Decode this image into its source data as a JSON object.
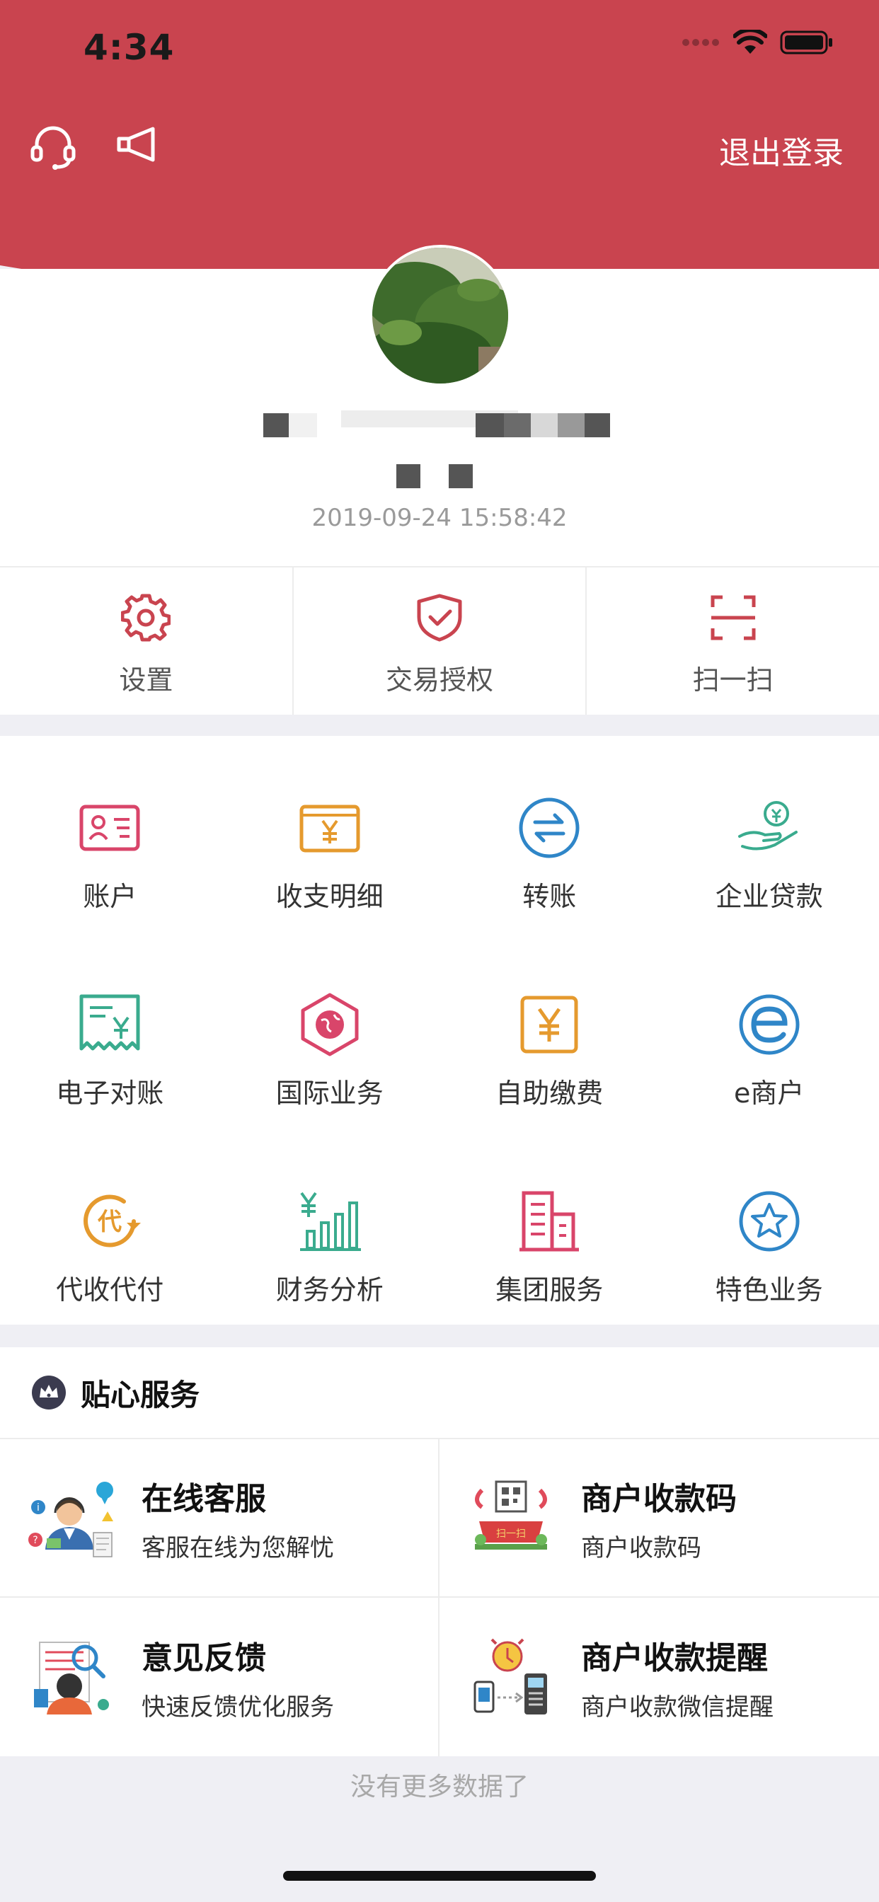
{
  "status_bar": {
    "time": "4:34"
  },
  "header": {
    "logout_label": "退出登录",
    "brand_color": "#c9444f",
    "icons": [
      "headset-icon",
      "megaphone-icon"
    ]
  },
  "profile": {
    "login_time": "2019-09-24 15:58:42"
  },
  "quick_actions": [
    {
      "label": "设置",
      "icon": "gear-icon"
    },
    {
      "label": "交易授权",
      "icon": "shield-check-icon"
    },
    {
      "label": "扫一扫",
      "icon": "scan-icon"
    }
  ],
  "functions": [
    {
      "label": "账户",
      "icon": "id-card-icon",
      "color": "#d9456a"
    },
    {
      "label": "收支明细",
      "icon": "yuan-card-icon",
      "color": "#e59a2e"
    },
    {
      "label": "转账",
      "icon": "transfer-icon",
      "color": "#2f86c8"
    },
    {
      "label": "企业贷款",
      "icon": "loan-hand-icon",
      "color": "#3aab8e"
    },
    {
      "label": "电子对账",
      "icon": "receipt-icon",
      "color": "#3aab8e"
    },
    {
      "label": "国际业务",
      "icon": "globe-hexagon-icon",
      "color": "#d9456a"
    },
    {
      "label": "自助缴费",
      "icon": "yuan-box-icon",
      "color": "#e59a2e"
    },
    {
      "label": "e商户",
      "icon": "e-merchant-icon",
      "color": "#2f86c8"
    },
    {
      "label": "代收代付",
      "icon": "collect-pay-icon",
      "color": "#e59a2e"
    },
    {
      "label": "财务分析",
      "icon": "finance-chart-icon",
      "color": "#3aab8e"
    },
    {
      "label": "集团服务",
      "icon": "buildings-icon",
      "color": "#d9456a"
    },
    {
      "label": "特色业务",
      "icon": "star-badge-icon",
      "color": "#2f86c8"
    }
  ],
  "services": {
    "title": "贴心服务",
    "items": [
      {
        "title": "在线客服",
        "subtitle": "客服在线为您解忧",
        "icon": "customer-service-illustration"
      },
      {
        "title": "商户收款码",
        "subtitle": "商户收款码",
        "icon": "payment-qr-illustration"
      },
      {
        "title": "意见反馈",
        "subtitle": "快速反馈优化服务",
        "icon": "feedback-illustration"
      },
      {
        "title": "商户收款提醒",
        "subtitle": "商户收款微信提醒",
        "icon": "payment-reminder-illustration"
      }
    ]
  },
  "footer": {
    "no_more": "没有更多数据了"
  }
}
